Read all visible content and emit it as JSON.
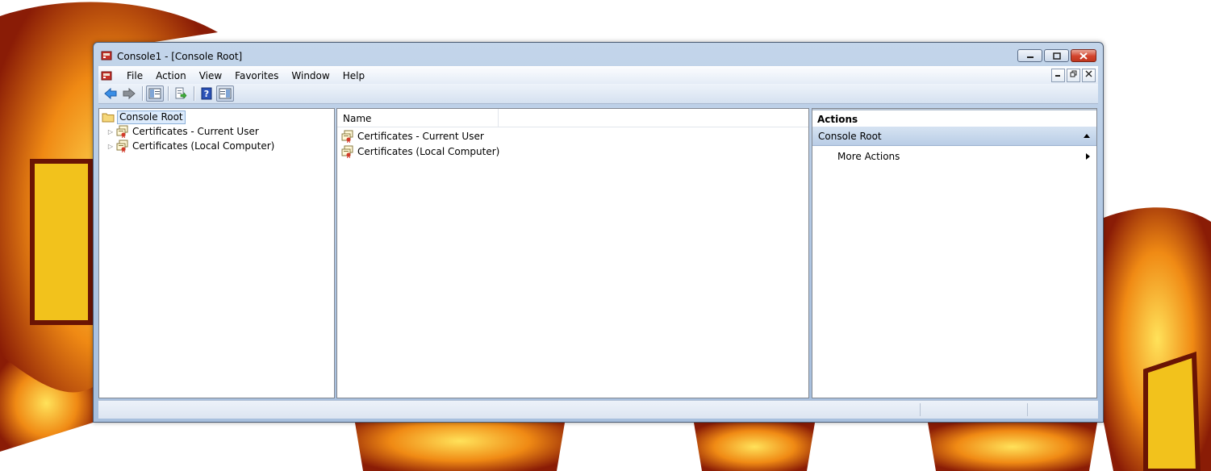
{
  "window": {
    "title": "Console1 - [Console Root]"
  },
  "menu": {
    "items": [
      "File",
      "Action",
      "View",
      "Favorites",
      "Window",
      "Help"
    ]
  },
  "toolbar": {
    "buttons": [
      "back-arrow-icon",
      "forward-arrow-icon",
      "show-hide-tree-icon",
      "export-list-icon",
      "help-icon",
      "show-hide-action-pane-icon"
    ]
  },
  "tree": {
    "root_label": "Console Root",
    "nodes": [
      {
        "label": "Certificates - Current User"
      },
      {
        "label": "Certificates (Local Computer)"
      }
    ]
  },
  "list": {
    "column_name": "Name",
    "rows": [
      {
        "label": "Certificates - Current User"
      },
      {
        "label": "Certificates (Local Computer)"
      }
    ]
  },
  "actions": {
    "header": "Actions",
    "section": "Console Root",
    "item": "More Actions"
  },
  "colors": {
    "selection_bg": "#dcebfc",
    "frame": "#aec5e2",
    "close_button": "#d2432c"
  }
}
